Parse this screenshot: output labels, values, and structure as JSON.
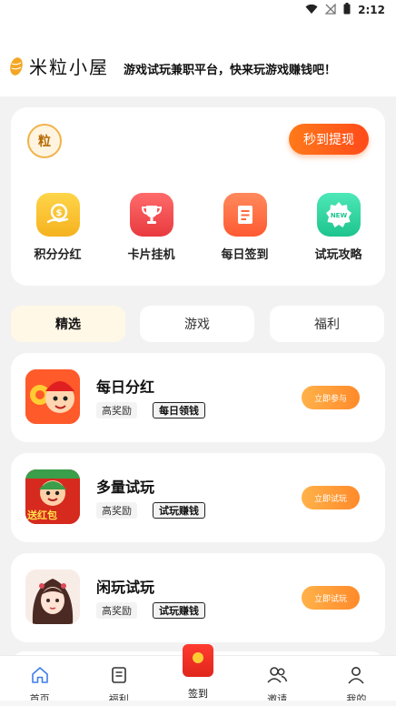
{
  "status_bar": {
    "time": "2:12",
    "wifi_icon": "wifi-icon",
    "signal_icon": "no-signal-icon",
    "battery_icon": "battery-icon"
  },
  "brand": {
    "name": "米粒小屋",
    "tagline": "游戏试玩兼职平台，快来玩游戏赚钱吧！",
    "logo_icon": "rice-grain-icon"
  },
  "top_card": {
    "coin_logo_text": "粒",
    "withdraw_label": "秒到提现",
    "menu": [
      {
        "label": "积分分红",
        "icon": "coin-hand-icon",
        "color": "#f5b91e"
      },
      {
        "label": "卡片挂机",
        "icon": "trophy-icon",
        "color": "#f0464a"
      },
      {
        "label": "每日签到",
        "icon": "checklist-icon",
        "color": "#ff6a3d"
      },
      {
        "label": "试玩攻略",
        "icon": "new-badge-icon",
        "color": "#2fd6a0"
      }
    ]
  },
  "tabs": [
    {
      "label": "精选",
      "active": true
    },
    {
      "label": "游戏",
      "active": false
    },
    {
      "label": "福利",
      "active": false
    }
  ],
  "games": [
    {
      "title": "每日分红",
      "tag1": "高奖励",
      "tag2": "每日领钱",
      "button": "立即参与"
    },
    {
      "title": "多量试玩",
      "tag1": "高奖励",
      "tag2": "试玩赚钱",
      "button": "立即试玩",
      "thumb_text": "送红包"
    },
    {
      "title": "闲玩试玩",
      "tag1": "高奖励",
      "tag2": "试玩赚钱",
      "button": "立即试玩"
    }
  ],
  "bottom_nav": [
    {
      "label": "首页",
      "icon": "home-icon",
      "active": true
    },
    {
      "label": "福利",
      "icon": "document-icon",
      "active": false
    },
    {
      "label": "签到",
      "icon": "red-envelope-icon",
      "active": false
    },
    {
      "label": "邀请",
      "icon": "users-icon",
      "active": false
    },
    {
      "label": "我的",
      "icon": "user-icon",
      "active": false
    }
  ]
}
